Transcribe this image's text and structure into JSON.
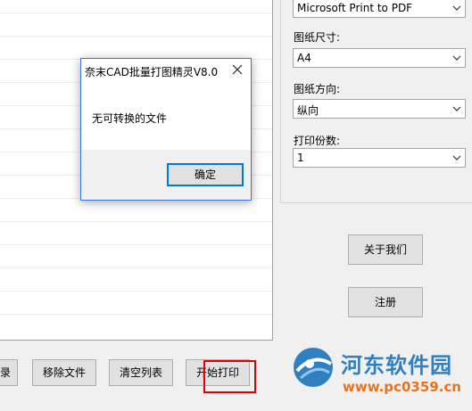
{
  "settings": {
    "printer_value": "Microsoft Print to PDF",
    "paper_size_label": "图纸尺寸:",
    "paper_size_value": "A4",
    "orientation_label": "图纸方向:",
    "orientation_value": "纵向",
    "copies_label": "打印份数:",
    "copies_value": "1"
  },
  "side_buttons": {
    "about": "关于我们",
    "register": "注册"
  },
  "toolbar": {
    "partial": "录",
    "remove_files": "移除文件",
    "clear_list": "清空列表",
    "start_print": "开始打印"
  },
  "dialog": {
    "title": "奈末CAD批量打图精灵V8.0",
    "message": "无可转换的文件",
    "ok": "确定"
  },
  "watermark": {
    "title": "河东软件园",
    "url": "www.pc0359.cn"
  }
}
